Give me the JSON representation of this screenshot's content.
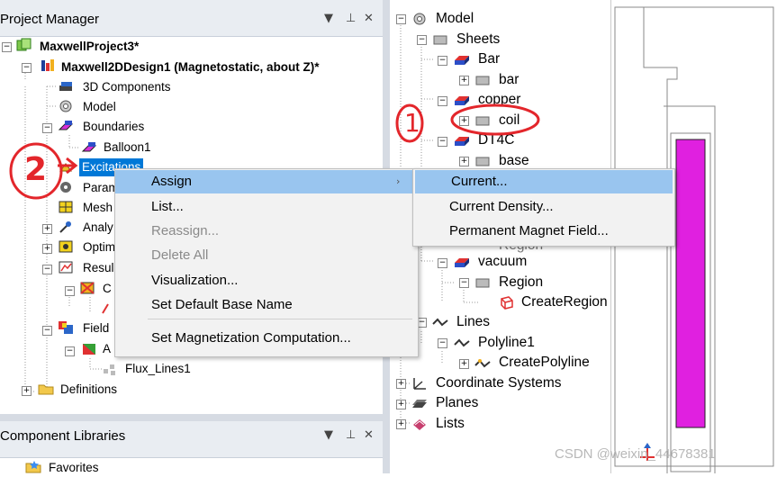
{
  "project_manager": {
    "title": "Project Manager",
    "items": [
      {
        "label": "MaxwellProject3*"
      },
      {
        "label": "Maxwell2DDesign1 (Magnetostatic, about Z)*"
      },
      {
        "label": "3D Components"
      },
      {
        "label": "Model"
      },
      {
        "label": "Boundaries"
      },
      {
        "label": "Balloon1"
      },
      {
        "label": "Excitations"
      },
      {
        "label": "Param"
      },
      {
        "label": "Mesh"
      },
      {
        "label": "Analy"
      },
      {
        "label": "Optim"
      },
      {
        "label": "Resul"
      },
      {
        "label": "C"
      },
      {
        "label": "Field"
      },
      {
        "label": "A"
      },
      {
        "label": "Flux_Lines1"
      },
      {
        "label": "Definitions"
      }
    ]
  },
  "component_libraries": {
    "title": "Component Libraries",
    "items": [
      {
        "label": "Favorites"
      }
    ]
  },
  "model_tree": {
    "items": [
      {
        "label": "Model"
      },
      {
        "label": "Sheets"
      },
      {
        "label": "Bar"
      },
      {
        "label": "bar"
      },
      {
        "label": "copper"
      },
      {
        "label": "coil"
      },
      {
        "label": "DT4C"
      },
      {
        "label": "base"
      },
      {
        "label": "Region"
      },
      {
        "label": "vacuum"
      },
      {
        "label": "Region"
      },
      {
        "label": "CreateRegion"
      },
      {
        "label": "Lines"
      },
      {
        "label": "Polyline1"
      },
      {
        "label": "CreatePolyline"
      },
      {
        "label": "Coordinate Systems"
      },
      {
        "label": "Planes"
      },
      {
        "label": "Lists"
      }
    ]
  },
  "context_menu": {
    "items": [
      {
        "label": "Assign"
      },
      {
        "label": "List..."
      },
      {
        "label": "Reassign..."
      },
      {
        "label": "Delete All"
      },
      {
        "label": "Visualization..."
      },
      {
        "label": "Set Default Base Name"
      },
      {
        "label": "Set Magnetization Computation..."
      }
    ]
  },
  "submenu": {
    "items": [
      {
        "label": "Current..."
      },
      {
        "label": "Current Density..."
      },
      {
        "label": "Permanent Magnet Field..."
      }
    ]
  },
  "annotations": {
    "one": "1",
    "two": "2"
  },
  "watermark": "CSDN @weixin_44678381",
  "colors": {
    "highlight": "#99c5ef",
    "selection": "#0078d7",
    "annotation": "#e3262b",
    "coil_fill": "#e020e0"
  }
}
